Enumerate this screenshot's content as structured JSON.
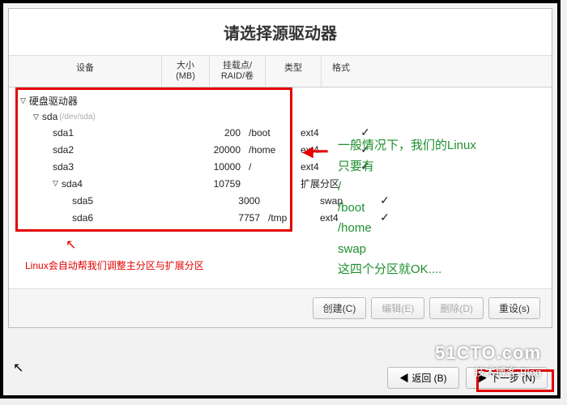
{
  "dialog": {
    "title": "请选择源驱动器"
  },
  "columns": {
    "device": "设备",
    "size": "大小\n(MB)",
    "mount": "挂载点/\nRAID/卷",
    "type": "类型",
    "format": "格式"
  },
  "tree": {
    "root": "硬盘驱动器",
    "disk": "sda",
    "disk_path": "(/dev/sda)",
    "rows": [
      {
        "name": "sda1",
        "size": "200",
        "mount": "/boot",
        "type": "ext4",
        "format": "✓"
      },
      {
        "name": "sda2",
        "size": "20000",
        "mount": "/home",
        "type": "ext4",
        "format": "✓"
      },
      {
        "name": "sda3",
        "size": "10000",
        "mount": "/",
        "type": "ext4",
        "format": "✓"
      },
      {
        "name": "sda4",
        "size": "10759",
        "mount": "",
        "type": "扩展分区",
        "format": ""
      },
      {
        "name": "sda5",
        "size": "3000",
        "mount": "",
        "type": "swap",
        "format": "✓"
      },
      {
        "name": "sda6",
        "size": "7757",
        "mount": "/tmp",
        "type": "ext4",
        "format": "✓"
      }
    ]
  },
  "annotation": {
    "line1": "一般情况下，我们的Linux",
    "line2": "只要有",
    "line3": "/",
    "line4": "/boot",
    "line5": "/home",
    "line6": "swap",
    "line7": "这四个分区就OK...."
  },
  "red_note": "Linux会自动帮我们调整主分区与扩展分区",
  "buttons": {
    "create": "创建(C)",
    "edit": "编辑(E)",
    "delete": "删除(D)",
    "reset": "重设(s)",
    "back": "◀ 返回 (B)",
    "next": "▶ 下一步 (N)"
  },
  "watermark": {
    "big": "51CTO.com",
    "small": "技术博客-Blog"
  }
}
